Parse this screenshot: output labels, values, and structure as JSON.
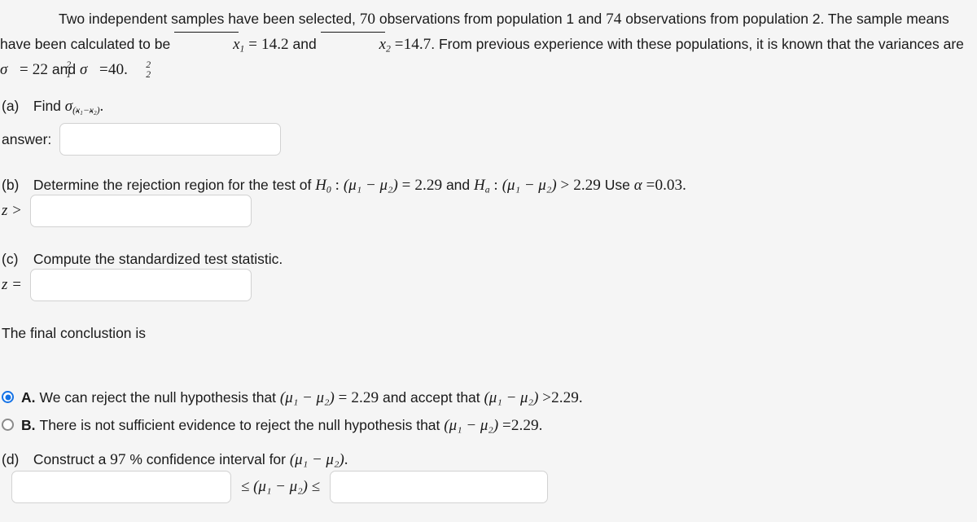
{
  "problem": {
    "intro": {
      "s1": "Two independent samples have been selected,",
      "n1": "70",
      "s2": "observations from population 1 and",
      "n2": "74",
      "s3": "observations from population 2. The sample means have been calculated to be",
      "xbar1_label": "x̄1",
      "mean1": "14.2",
      "s4": "and",
      "xbar2_label": "x̄2",
      "mean2": "14.7",
      "s5": ". From previous experience with these populations, it is known that the variances are",
      "var1_label": "σ²₁",
      "var1": "22",
      "s6": "and",
      "var2_label": "σ²₂",
      "var2": "40",
      "s7": "."
    },
    "part_a": {
      "tag": "(a)",
      "text": "Find",
      "symbol": "σ(x̄1−x̄2)",
      "answer_label": "answer:",
      "input_value": "",
      "input_placeholder": ""
    },
    "part_b": {
      "tag": "(b)",
      "text_1": "Determine the rejection region for the test of",
      "h0": "H₀",
      "h0_expr": "(μ₁ − μ₂)",
      "h0_rel": "=",
      "h0_value": "2.29",
      "and": "and",
      "ha": "Hₐ",
      "ha_expr": "(μ₁ − μ₂)",
      "ha_rel": ">",
      "ha_value": "2.29",
      "alpha_text": "Use",
      "alpha_symbol": "α",
      "alpha_value": "0.03",
      "prefix": "z >",
      "input_value": "",
      "input_placeholder": ""
    },
    "part_c": {
      "tag": "(c)",
      "text": "Compute the standardized test statistic.",
      "prefix": "z =",
      "input_value": "",
      "input_placeholder": ""
    },
    "conclusion": {
      "prompt": "The final conclustion is",
      "selected": "A",
      "options": [
        {
          "key": "A.",
          "text_1": "We can reject the null hypothesis that",
          "expr_1": "(μ₁ − μ₂)",
          "rel_1": "=",
          "val_1": "2.29",
          "text_2": "and accept that",
          "expr_2": "(μ₁ − μ₂)",
          "rel_2": ">",
          "val_2": "2.29",
          "tail": ".",
          "selected": true
        },
        {
          "key": "B.",
          "text_1": "There is not sufficient evidence to reject the null hypothesis that",
          "expr_1": "(μ₁ − μ₂)",
          "rel_1": "=",
          "val_1": "2.29",
          "text_2": "",
          "expr_2": "",
          "rel_2": "",
          "val_2": "",
          "tail": ".",
          "selected": false
        }
      ]
    },
    "part_d": {
      "tag": "(d)",
      "text_1": "Construct a",
      "confidence": "97",
      "text_2": "% confidence interval for",
      "expr": "(μ₁ − μ₂)",
      "tail": ".",
      "lower_value": "",
      "lower_placeholder": "",
      "upper_value": "",
      "upper_placeholder": "",
      "middle": "≤ (μ₁ − μ₂) ≤"
    }
  },
  "colors": {
    "background": "#f5f5f5",
    "text": "#1a1a1a",
    "radio_accent": "#1573e6",
    "input_border": "#d2d2d2",
    "input_background": "#ffffff"
  }
}
